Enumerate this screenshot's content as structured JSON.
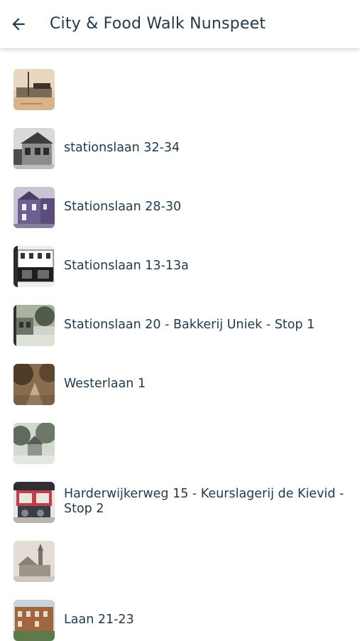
{
  "header": {
    "back_icon": "arrow-left-icon",
    "title": "City & Food Walk Nunspeet"
  },
  "stops": [
    {
      "label": "",
      "thumb": "sepia-station-photo"
    },
    {
      "label": "stationslaan 32-34",
      "thumb": "bw-villa-photo"
    },
    {
      "label": "Stationslaan 28-30",
      "thumb": "purple-house-photo"
    },
    {
      "label": "Stationslaan 13-13a",
      "thumb": "bw-shopfront-photo"
    },
    {
      "label": "Stationslaan 20 - Bakkerij Uniek - Stop 1",
      "thumb": "green-street-photo"
    },
    {
      "label": "Westerlaan 1",
      "thumb": "sepia-lane-photo"
    },
    {
      "label": "",
      "thumb": "grey-church-trees-photo"
    },
    {
      "label": "Harderwijkerweg 15 - Keurslagerij de Kievid - Stop 2",
      "thumb": "butcher-shop-photo"
    },
    {
      "label": "",
      "thumb": "church-tower-photo"
    },
    {
      "label": "Laan 21-23",
      "thumb": "brick-building-photo"
    }
  ],
  "colors": {
    "title_text": "#1f3a4d",
    "background": "#ffffff"
  }
}
